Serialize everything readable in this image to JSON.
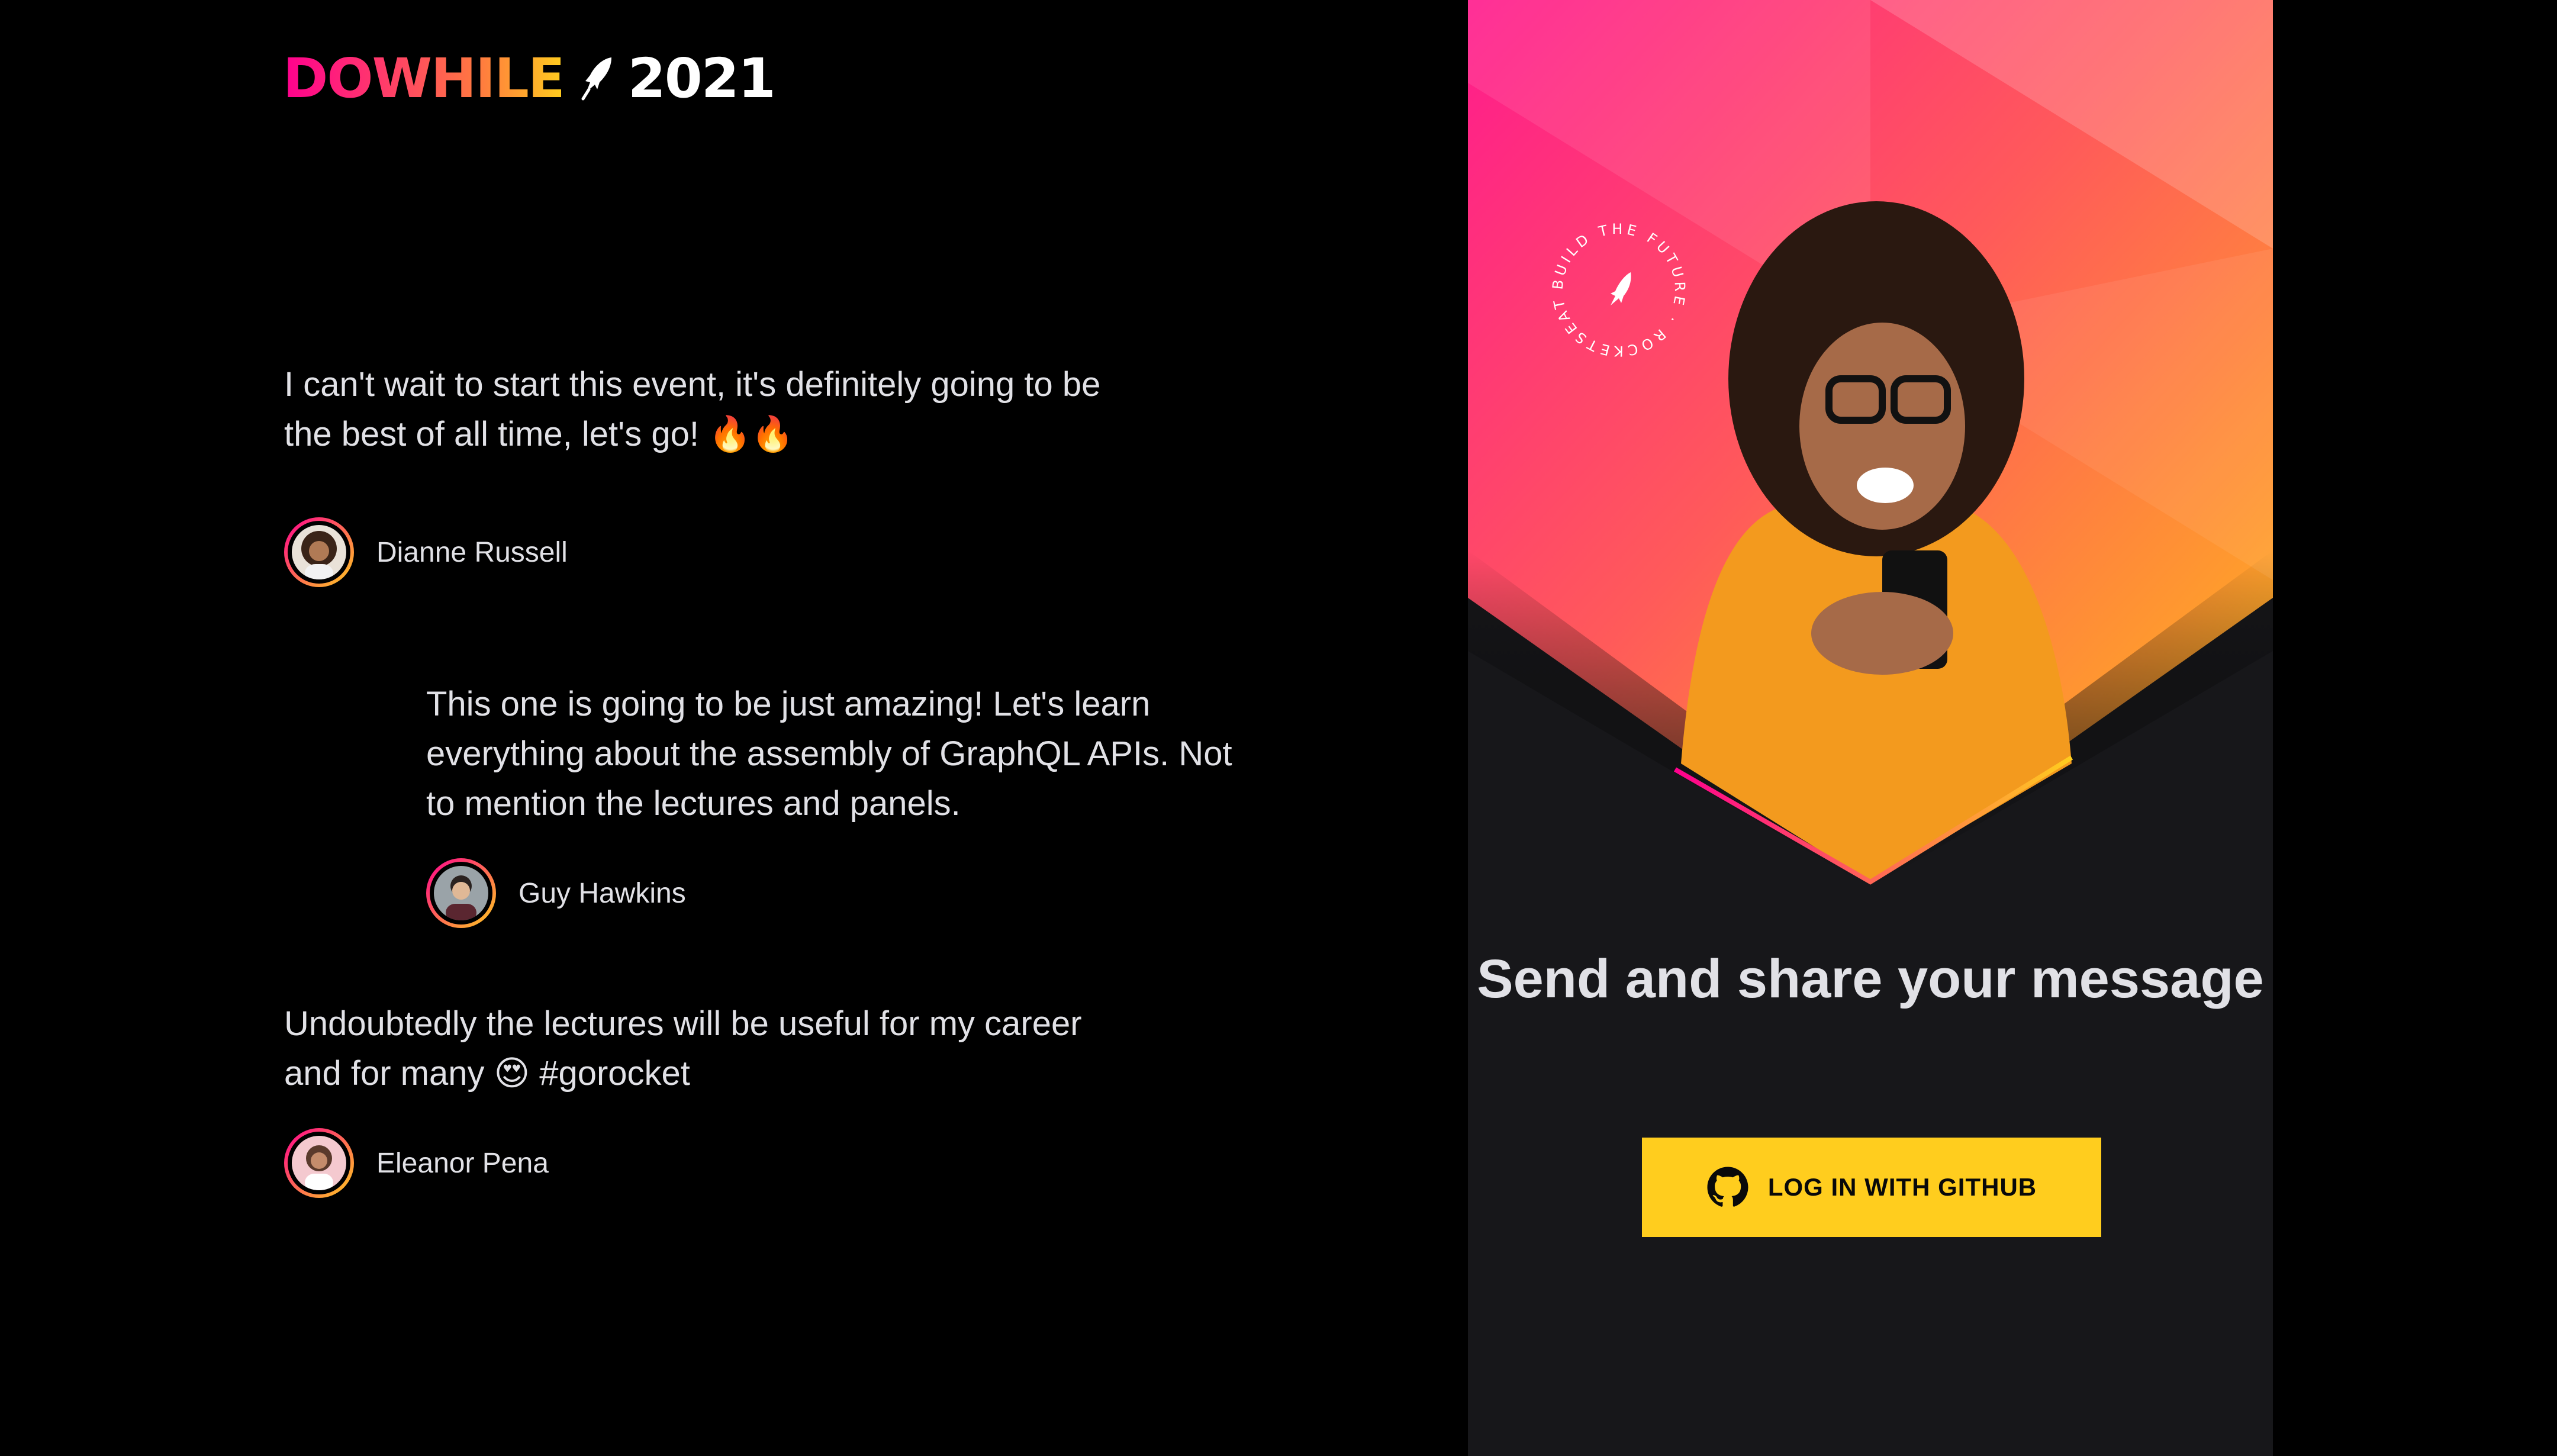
{
  "brand": {
    "logo_word": "DOWHILE",
    "logo_year": "2021",
    "rocket_icon": "rocket-icon"
  },
  "messages": [
    {
      "text": "I can't wait to start this event, it's definitely going to be the best of all time, let's go! 🔥🔥",
      "user": "Dianne Russell"
    },
    {
      "text": "This one is going to be just amazing! Let's learn everything about the assembly of GraphQL APIs. Not to mention the lectures and panels.",
      "user": "Guy Hawkins"
    },
    {
      "text": "Undoubtedly the lectures will be useful for my career and for many 😍 #gorocket",
      "user": "Eleanor Pena"
    }
  ],
  "sidebar": {
    "badge_text": "BUILD THE FUTURE · ROCKETSEAT ·",
    "title": "Send and share your message",
    "login_button": "LOG IN WITH GITHUB",
    "login_icon": "github-icon"
  },
  "colors": {
    "accent_pink": "#ff008e",
    "accent_yellow": "#ffcd1e",
    "panel_bg": "#17171a",
    "text": "#e1e1e6"
  }
}
